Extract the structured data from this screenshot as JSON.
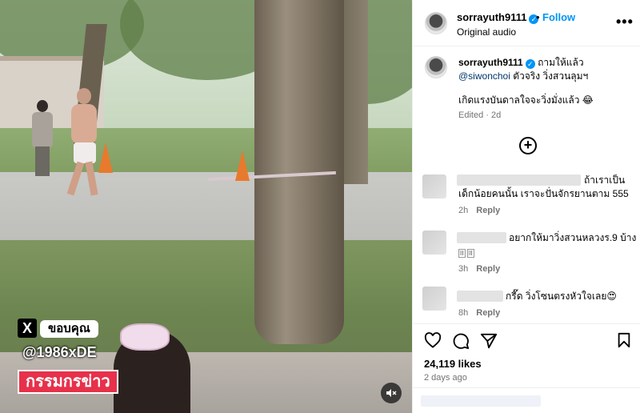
{
  "media": {
    "watermark_x": "X",
    "watermark_thanks": "ขอบคุณ",
    "watermark_handle": "@1986xDE",
    "watermark_brand": "กรรมกรข่าว",
    "mute_icon": "speaker-muted-icon"
  },
  "header": {
    "username": "sorrayuth9111",
    "dot": "•",
    "follow_label": "Follow",
    "audio": "Original audio",
    "more": "•••"
  },
  "caption": {
    "username": "sorrayuth9111",
    "text_part1": "ถามให้แล้ว",
    "mention": "@siwonchoi",
    "text_part2": "ตัวจริง วิ่งสวนลุมฯ",
    "line2": "เกิดแรงบันดาลใจจะวิ่งมั่งแล้ว 😂",
    "meta": "Edited · 2d",
    "load_more": "+"
  },
  "comments": [
    {
      "text": "ถ้าเราเป็นเด็กน้อยคนนั้น เราจะปั่นจักรยานตาม 555",
      "line1": "ถ้าเราเป็น",
      "line2": "เด็กน้อยคนนั้น เราจะปั่นจักรยานตาม 555",
      "age": "2h",
      "reply": "Reply"
    },
    {
      "text": "อยากให้มาวิ่งสวนหลวงร.9 บ้าง",
      "age": "3h",
      "reply": "Reply"
    },
    {
      "text": "กรี๊ด วิ่งโซนตรงหัวใจเลย😍",
      "age": "8h",
      "reply": "Reply"
    }
  ],
  "likes": "24,119 likes",
  "time_ago": "2 days ago",
  "colors": {
    "accent": "#0095f6",
    "brand_red": "#e7314b",
    "meta_gray": "#737373"
  }
}
